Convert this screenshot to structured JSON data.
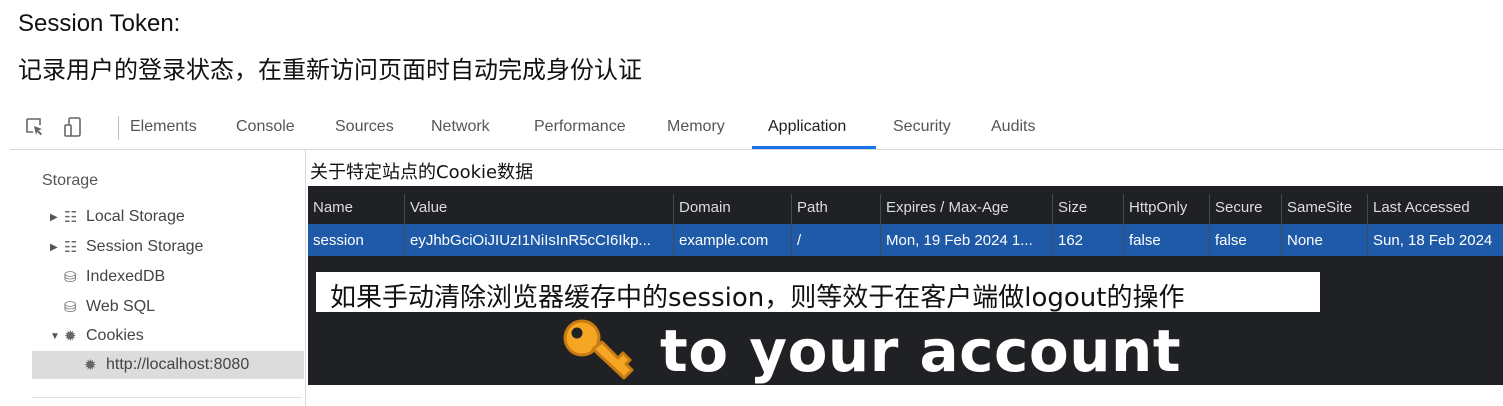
{
  "note": {
    "title": "Session Token:",
    "description": "记录用户的登录状态，在重新访问页面时自动完成身份认证"
  },
  "toolbar": {
    "icons": [
      "inspect-element-icon",
      "device-toggle-icon"
    ],
    "tabs": [
      {
        "label": "Elements"
      },
      {
        "label": "Console"
      },
      {
        "label": "Sources"
      },
      {
        "label": "Network"
      },
      {
        "label": "Performance"
      },
      {
        "label": "Memory"
      },
      {
        "label": "Application",
        "active": true
      },
      {
        "label": "Security"
      },
      {
        "label": "Audits"
      }
    ],
    "accent_color": "#1a73e8"
  },
  "sidebar": {
    "section_label": "Storage",
    "items": [
      {
        "label": "Local Storage",
        "icon": "grid-icon",
        "expandable": true
      },
      {
        "label": "Session Storage",
        "icon": "grid-icon",
        "expandable": true
      },
      {
        "label": "IndexedDB",
        "icon": "database-icon"
      },
      {
        "label": "Web SQL",
        "icon": "database-icon"
      },
      {
        "label": "Cookies",
        "icon": "cookie-icon",
        "expanded": true
      },
      {
        "label": "http://localhost:8080",
        "icon": "cookie-icon",
        "selected": true
      }
    ]
  },
  "cookie_panel": {
    "title": "关于特定站点的Cookie数据",
    "columns": [
      "Name",
      "Value",
      "Domain",
      "Path",
      "Expires / Max-Age",
      "Size",
      "HttpOnly",
      "Secure",
      "SameSite",
      "Last Accessed"
    ],
    "rows": [
      [
        "session",
        "eyJhbGciOiJIUzI1NiIsInR5cCI6Ikp...",
        "example.com",
        "/",
        "Mon, 19 Feb 2024 1...",
        "162",
        "false",
        "false",
        "None",
        "Sun, 18 Feb 2024"
      ]
    ],
    "selected_row_color": "#1f5aa8"
  },
  "caption": "如果手动清除浏览器缓存中的session，则等效于在客户端做logout的操作",
  "banner": {
    "icon": "key-icon",
    "text": "to your account"
  }
}
